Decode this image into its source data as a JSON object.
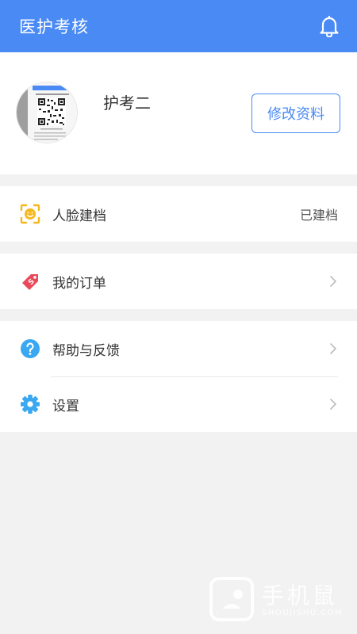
{
  "header": {
    "title": "医护考核",
    "bell_icon": "bell-icon"
  },
  "profile": {
    "username": "护考二",
    "edit_label": "修改资料",
    "avatar_icon": "qr-code-avatar-icon"
  },
  "menu": {
    "face": {
      "label": "人脸建档",
      "value": "已建档",
      "icon": "face-scan-icon",
      "color": "#f5b820"
    },
    "orders": {
      "label": "我的订单",
      "icon": "price-tag-icon",
      "color": "#e94a5a"
    },
    "help": {
      "label": "帮助与反馈",
      "icon": "question-icon",
      "color": "#3aa8f0"
    },
    "settings": {
      "label": "设置",
      "icon": "gear-icon",
      "color": "#3aa8f0"
    }
  },
  "watermark": {
    "text": "手机鼠",
    "sub": "SHOUJISHU.COM"
  },
  "colors": {
    "primary": "#4a8af4",
    "background": "#f2f2f2"
  }
}
